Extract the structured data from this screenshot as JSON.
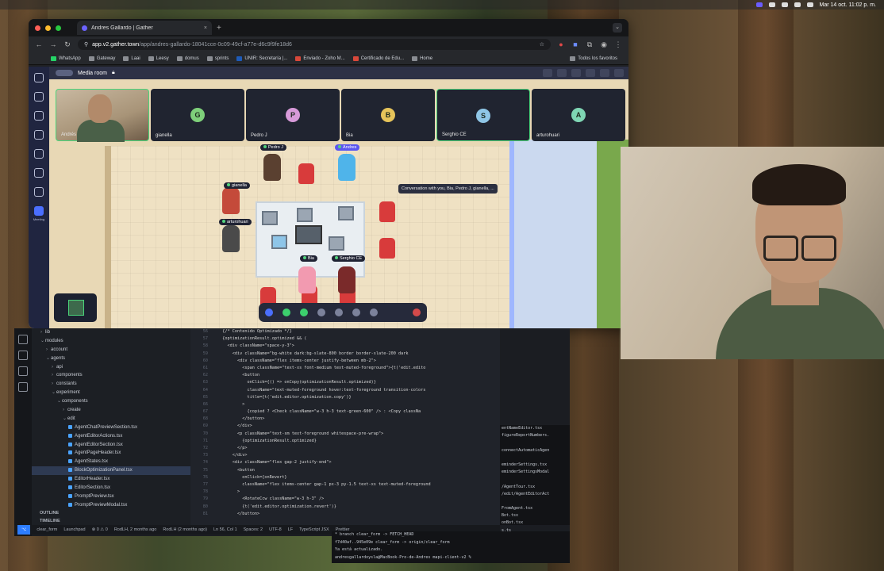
{
  "menubar": {
    "datetime": "Mar 14 oct. 11:02 p. m."
  },
  "browser": {
    "tab_title": "Andres Gallardo | Gather",
    "url_host": "app.v2.gather.town",
    "url_path": "/app/andres-gallardo-18041cce-0c09-49cf-a77e-d6c9f9fe18d6",
    "bookmarks": [
      "WhatsApp",
      "Gateway",
      "Laai",
      "Leesy",
      "domus",
      "sprints",
      "UNIR: Secretaría |...",
      "Enviado - Zoho M...",
      "Certificado de Edu...",
      "Home"
    ],
    "favorites": "Todos los favoritos"
  },
  "gather": {
    "room_label": "Media room",
    "sidebar_label": "Meeting",
    "videos": [
      {
        "name": "Andrés",
        "initial": "",
        "color": ""
      },
      {
        "name": "gianella",
        "initial": "G",
        "color": "#7ed07a"
      },
      {
        "name": "Pedro J",
        "initial": "P",
        "color": "#d79ad9"
      },
      {
        "name": "Bia",
        "initial": "B",
        "color": "#e6c45a"
      },
      {
        "name": "Serghio CE",
        "initial": "S",
        "color": "#8fc6e6"
      },
      {
        "name": "arturohuari",
        "initial": "A",
        "color": "#7fd6b4"
      }
    ],
    "tags": {
      "pedro": "Pedro J",
      "andres": "Andres",
      "gianella": "gianella",
      "arturo": "arturohuari",
      "bia": "Bia",
      "serghio": "Serghio CE"
    },
    "tooltip": "Conversation with you, Bia, Pedro J, gianella, ..."
  },
  "explorer": {
    "rows": [
      {
        "label": "lib",
        "indent": 1,
        "type": "dir",
        "open": false
      },
      {
        "label": "modules",
        "indent": 1,
        "type": "dir",
        "open": true
      },
      {
        "label": "account",
        "indent": 2,
        "type": "dir",
        "open": false
      },
      {
        "label": "agents",
        "indent": 2,
        "type": "dir",
        "open": true
      },
      {
        "label": "api",
        "indent": 3,
        "type": "dir",
        "open": false
      },
      {
        "label": "components",
        "indent": 3,
        "type": "dir",
        "open": false
      },
      {
        "label": "constants",
        "indent": 3,
        "type": "dir",
        "open": false
      },
      {
        "label": "experiment",
        "indent": 3,
        "type": "dir",
        "open": true
      },
      {
        "label": "components",
        "indent": 4,
        "type": "dir",
        "open": true
      },
      {
        "label": "create",
        "indent": 5,
        "type": "dir",
        "open": false
      },
      {
        "label": "edit",
        "indent": 5,
        "type": "dir",
        "open": true
      },
      {
        "label": "AgentChatPreviewSection.tsx",
        "indent": 6,
        "type": "file"
      },
      {
        "label": "AgentEditorActions.tsx",
        "indent": 6,
        "type": "file"
      },
      {
        "label": "AgentEditorSection.tsx",
        "indent": 6,
        "type": "file"
      },
      {
        "label": "AgentPageHeader.tsx",
        "indent": 6,
        "type": "file"
      },
      {
        "label": "AgentStates.tsx",
        "indent": 6,
        "type": "file"
      },
      {
        "label": "BlockOptimizationPanel.tsx",
        "indent": 6,
        "type": "file",
        "selected": true
      },
      {
        "label": "EditorHeader.tsx",
        "indent": 6,
        "type": "file"
      },
      {
        "label": "EditorSection.tsx",
        "indent": 6,
        "type": "file"
      },
      {
        "label": "PromptPreview.tsx",
        "indent": 6,
        "type": "file"
      },
      {
        "label": "PromptPreviewModal.tsx",
        "indent": 6,
        "type": "file"
      }
    ],
    "outline": "OUTLINE",
    "timeline": "TIMELINE"
  },
  "code": {
    "lines": [
      {
        "n": "56",
        "t": "  {/* Contenido Optimizado */}"
      },
      {
        "n": "57",
        "t": "  {optimizationResult.optimized && ("
      },
      {
        "n": "58",
        "t": "    <div className=\"space-y-3\">"
      },
      {
        "n": "59",
        "t": "      <div className=\"bg-white dark:bg-slate-800 border border-slate-200 dark"
      },
      {
        "n": "60",
        "t": "        <div className=\"flex items-center justify-between mb-2\">"
      },
      {
        "n": "61",
        "t": "          <span className=\"text-xs font-medium text-muted-foreground\">{t('edit.edito"
      },
      {
        "n": "62",
        "t": "          <button"
      },
      {
        "n": "63",
        "t": "            onClick={() => onCopy(optimizationResult.optimized)}"
      },
      {
        "n": "64",
        "t": "            className=\"text-muted-foreground hover:text-foreground transition-colors"
      },
      {
        "n": "65",
        "t": "            title={t('edit.editor.optimization.copy')}"
      },
      {
        "n": "66",
        "t": "          >"
      },
      {
        "n": "67",
        "t": "            {copied ? <Check className=\"w-3 h-3 text-green-600\" /> : <Copy classNa"
      },
      {
        "n": "68",
        "t": "          </button>"
      },
      {
        "n": "69",
        "t": "        </div>"
      },
      {
        "n": "70",
        "t": "        <p className=\"text-sm text-foreground whitespace-pre-wrap\">"
      },
      {
        "n": "71",
        "t": "          {optimizationResult.optimized}"
      },
      {
        "n": "72",
        "t": "        </p>"
      },
      {
        "n": "73",
        "t": "      </div>"
      },
      {
        "n": "74",
        "t": "      <div className=\"flex gap-2 justify-end\">"
      },
      {
        "n": "75",
        "t": "        <button"
      },
      {
        "n": "76",
        "t": "          onClick={onRevert}"
      },
      {
        "n": "77",
        "t": "          className=\"flex items-center gap-1 px-3 py-1.5 text-xs text-muted-foreground"
      },
      {
        "n": "78",
        "t": "        >"
      },
      {
        "n": "79",
        "t": "          <RotateCcw className=\"w-3 h-3\" />"
      },
      {
        "n": "80",
        "t": "          {t('edit.editor.optimization.revert')}"
      },
      {
        "n": "81",
        "t": "        </button>"
      }
    ]
  },
  "terminal_side": [
    "entNameEditor.tsx",
    "figureReportNumbers.",
    "",
    "connectAutomaticAgen",
    "",
    "eminderSettings.tsx",
    "eminderSettingsModal",
    "",
    "/AgentTour.tsx",
    "/edit/AgentEditorAct",
    "",
    "FromAgent.tsx",
    "Bot.tsx",
    "onBot.tsx",
    "s.ts",
    "",
    "t pull origin clear_"
  ],
  "terminal_bottom": [
    "* branch            clear_form -> FETCH_HEAD",
    "f7d40af..945e09e  clear_form -> origin/clear_form",
    "Ya está actualizado.",
    "andresgallardoysla@MacBook-Pro-de-Andres mapi-client-v2 % "
  ],
  "status": {
    "branch": "clear_form",
    "launchpad": "Launchpad",
    "problems": "⊗ 0 ⚠ 0",
    "blame1": "RodLH, 2 months ago",
    "blame2": "RodLH (2 months ago)",
    "position": "Ln 56, Col 1",
    "spaces": "Spaces: 2",
    "encoding": "UTF-8",
    "eol": "LF",
    "language": "TypeScript JSX",
    "formatter": "Prettier"
  }
}
